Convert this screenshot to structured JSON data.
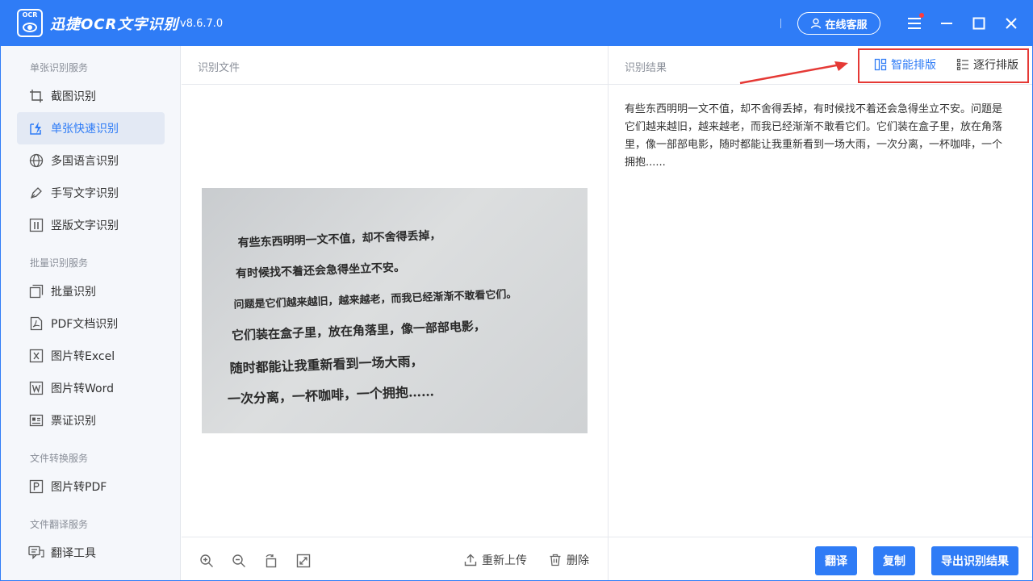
{
  "app": {
    "logo_text": "OCR",
    "title": "迅捷OCR文字识别",
    "version": "v8.6.7.0",
    "service_label": "在线客服"
  },
  "sidebar": {
    "sections": [
      {
        "title": "单张识别服务"
      },
      {
        "title": "批量识别服务"
      },
      {
        "title": "文件转换服务"
      },
      {
        "title": "文件翻译服务"
      }
    ],
    "items": [
      {
        "label": "截图识别",
        "icon": "crop-icon"
      },
      {
        "label": "单张快速识别",
        "icon": "quick-scan-icon",
        "active": true
      },
      {
        "label": "多国语言识别",
        "icon": "globe-icon"
      },
      {
        "label": "手写文字识别",
        "icon": "pen-icon"
      },
      {
        "label": "竖版文字识别",
        "icon": "vertical-text-icon"
      },
      {
        "label": "批量识别",
        "icon": "batch-icon"
      },
      {
        "label": "PDF文档识别",
        "icon": "pdf-icon"
      },
      {
        "label": "图片转Excel",
        "icon": "excel-icon"
      },
      {
        "label": "图片转Word",
        "icon": "word-icon"
      },
      {
        "label": "票证识别",
        "icon": "ticket-icon"
      },
      {
        "label": "图片转PDF",
        "icon": "image-pdf-icon"
      },
      {
        "label": "翻译工具",
        "icon": "translate-icon"
      }
    ]
  },
  "center": {
    "header": "识别文件",
    "photo_lines": [
      "有些东西明明一文不值，却不舍得丢掉，",
      "有时候找不着还会急得坐立不安。",
      "问题是它们越来越旧，越来越老，而我已经渐渐不敢看它们。",
      "它们装在盒子里，放在角落里，像一部部电影，",
      "随时都能让我重新看到一场大雨，",
      "一次分离，一杯咖啡，一个拥抱……"
    ],
    "reupload_label": "重新上传",
    "delete_label": "删除"
  },
  "right": {
    "header": "识别结果",
    "smart_layout_label": "智能排版",
    "line_layout_label": "逐行排版",
    "result_text": "有些东西明明一文不值，却不舍得丢掉，有时候找不着还会急得坐立不安。问题是它们越来越旧，越来越老，而我已经渐渐不敢看它们。它们装在盒子里，放在角落里，像一部部电影，随时都能让我重新看到一场大雨，一次分离，一杯咖啡，一个拥抱......",
    "translate_label": "翻译",
    "copy_label": "复制",
    "export_label": "导出识别结果"
  },
  "colors": {
    "primary": "#2f7cf6",
    "annotation_red": "#e53935",
    "sidebar_bg": "#f5f7fb"
  }
}
